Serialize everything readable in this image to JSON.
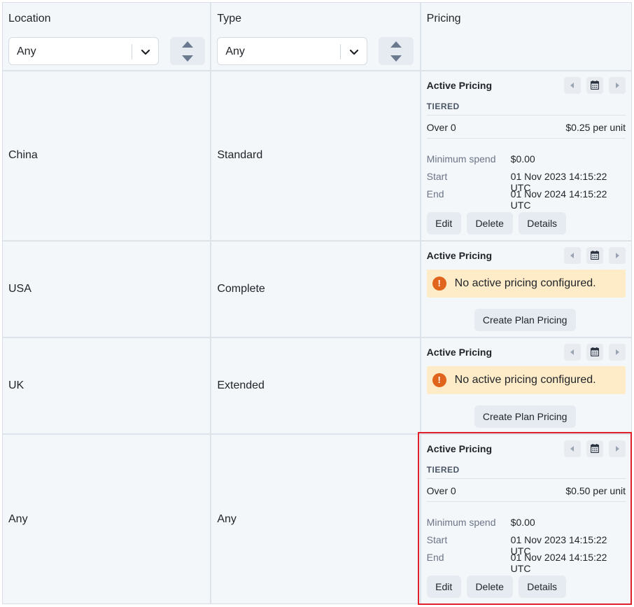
{
  "header": {
    "location_label": "Location",
    "type_label": "Type",
    "pricing_label": "Pricing",
    "location_filter_value": "Any",
    "type_filter_value": "Any"
  },
  "rows": [
    {
      "location": "China",
      "type": "Standard",
      "pricing": {
        "title": "Active Pricing",
        "model": "TIERED",
        "tier_label": "Over 0",
        "tier_price": "$0.25 per unit",
        "min_spend_label": "Minimum spend",
        "min_spend_value": "$0.00",
        "start_label": "Start",
        "start_value": "01 Nov 2023 14:15:22 UTC",
        "end_label": "End",
        "end_value": "01 Nov 2024 14:15:22 UTC",
        "edit_label": "Edit",
        "delete_label": "Delete",
        "details_label": "Details"
      }
    },
    {
      "location": "USA",
      "type": "Complete",
      "pricing": {
        "title": "Active Pricing",
        "warning": "No active pricing configured.",
        "create_label": "Create Plan Pricing"
      }
    },
    {
      "location": "UK",
      "type": "Extended",
      "pricing": {
        "title": "Active Pricing",
        "warning": "No active pricing configured.",
        "create_label": "Create Plan Pricing"
      }
    },
    {
      "location": "Any",
      "type": "Any",
      "pricing": {
        "title": "Active Pricing",
        "model": "TIERED",
        "tier_label": "Over 0",
        "tier_price": "$0.50 per unit",
        "min_spend_label": "Minimum spend",
        "min_spend_value": "$0.00",
        "start_label": "Start",
        "start_value": "01 Nov 2023 14:15:22 UTC",
        "end_label": "End",
        "end_value": "01 Nov 2024 14:15:22 UTC",
        "edit_label": "Edit",
        "delete_label": "Delete",
        "details_label": "Details"
      }
    }
  ],
  "icons": {
    "warning": "exclamation-circle-icon",
    "calendar": "calendar-icon",
    "prev": "caret-left-icon",
    "next": "caret-right-icon",
    "sort": "sort-arrows-icon",
    "dropdown": "chevron-down-icon"
  },
  "colors": {
    "warning_bg": "#feecc8",
    "warning_icon": "#e0641b",
    "highlight_border": "#e0202b"
  }
}
